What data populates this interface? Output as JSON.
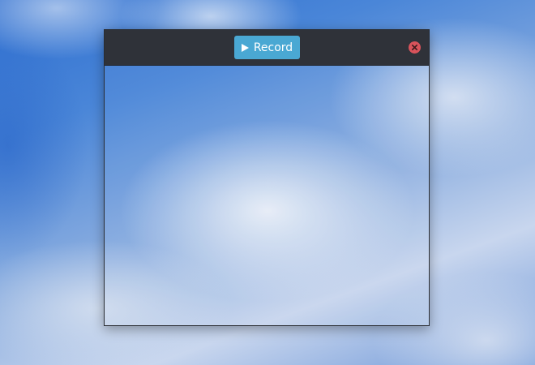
{
  "toolbar": {
    "record_label": "Record",
    "record_icon": "play-icon",
    "close_icon": "close-icon"
  },
  "colors": {
    "titlebar": "#2f3239",
    "record_button": "#4aa8d3",
    "close_button": "#d9535b"
  }
}
